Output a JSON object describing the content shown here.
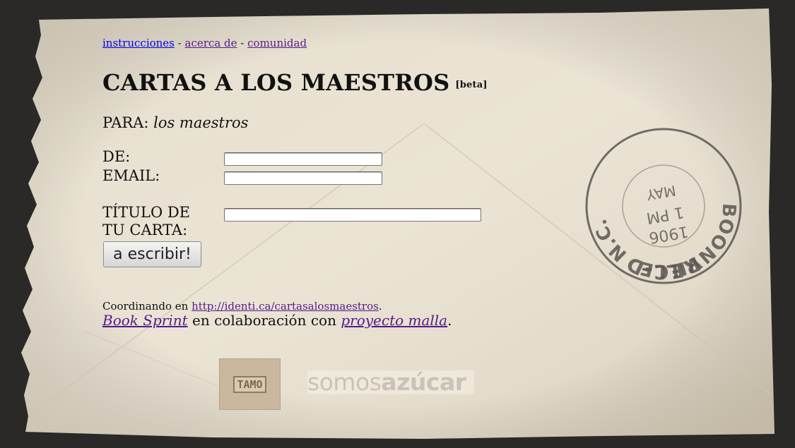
{
  "nav": {
    "instrucciones": "instrucciones",
    "sep1": "-",
    "acerca": "acerca de",
    "sep2": "-",
    "comunidad": "comunidad"
  },
  "header": {
    "title": "CARTAS A LOS MAESTROS",
    "badge": "[beta]"
  },
  "recipient": {
    "label": "PARA:",
    "value": "los maestros"
  },
  "form": {
    "de_label": "DE:",
    "email_label": "EMAIL:",
    "titulo_label": "TÍTULO DE TU CARTA:",
    "submit_label": "a escribir!"
  },
  "footer": {
    "coord_text": "Coordinando en",
    "coord_link": "http://identi.ca/cartasalosmaestros",
    "coord_end": ".",
    "booksprint": "Book Sprint",
    "collab_text": " en colaboración con ",
    "malla": "proyecto malla",
    "collab_end": "."
  },
  "logos": {
    "tamo": "TAMO",
    "somos_a": "somos",
    "somos_b": "azúcar"
  },
  "stamp": {
    "top": "REC-D",
    "right": "BOONVILLE",
    "left": "N.C.",
    "time": "1 PM",
    "year": "1906",
    "month": "MAY"
  },
  "colors": {
    "paper": "#e8e0d0",
    "link": "#0000ee",
    "visited_link": "#551a8b",
    "stamp_ink": "#5a5652"
  }
}
